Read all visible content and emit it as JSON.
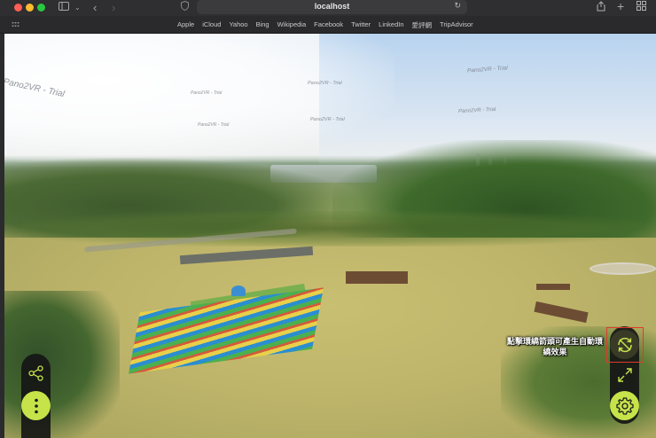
{
  "browser": {
    "url": "localhost",
    "favorites": [
      "Apple",
      "iCloud",
      "Yahoo",
      "Bing",
      "Wikipedia",
      "Facebook",
      "Twitter",
      "LinkedIn",
      "愛評網",
      "TripAdvisor"
    ]
  },
  "panorama": {
    "watermark_text": "Pano2VR - Trial",
    "autorotate_hint": "點擊環繞箭頭可產生自動環繞效果"
  },
  "colors": {
    "accent": "#c6e34a",
    "highlight": "#e03a2e",
    "control_bg": "#141414"
  },
  "icons": {
    "share": "share-icon",
    "menu": "vertical-dots-icon",
    "autorotate": "autorotate-icon",
    "fullscreen": "fullscreen-icon",
    "settings": "gear-icon"
  }
}
